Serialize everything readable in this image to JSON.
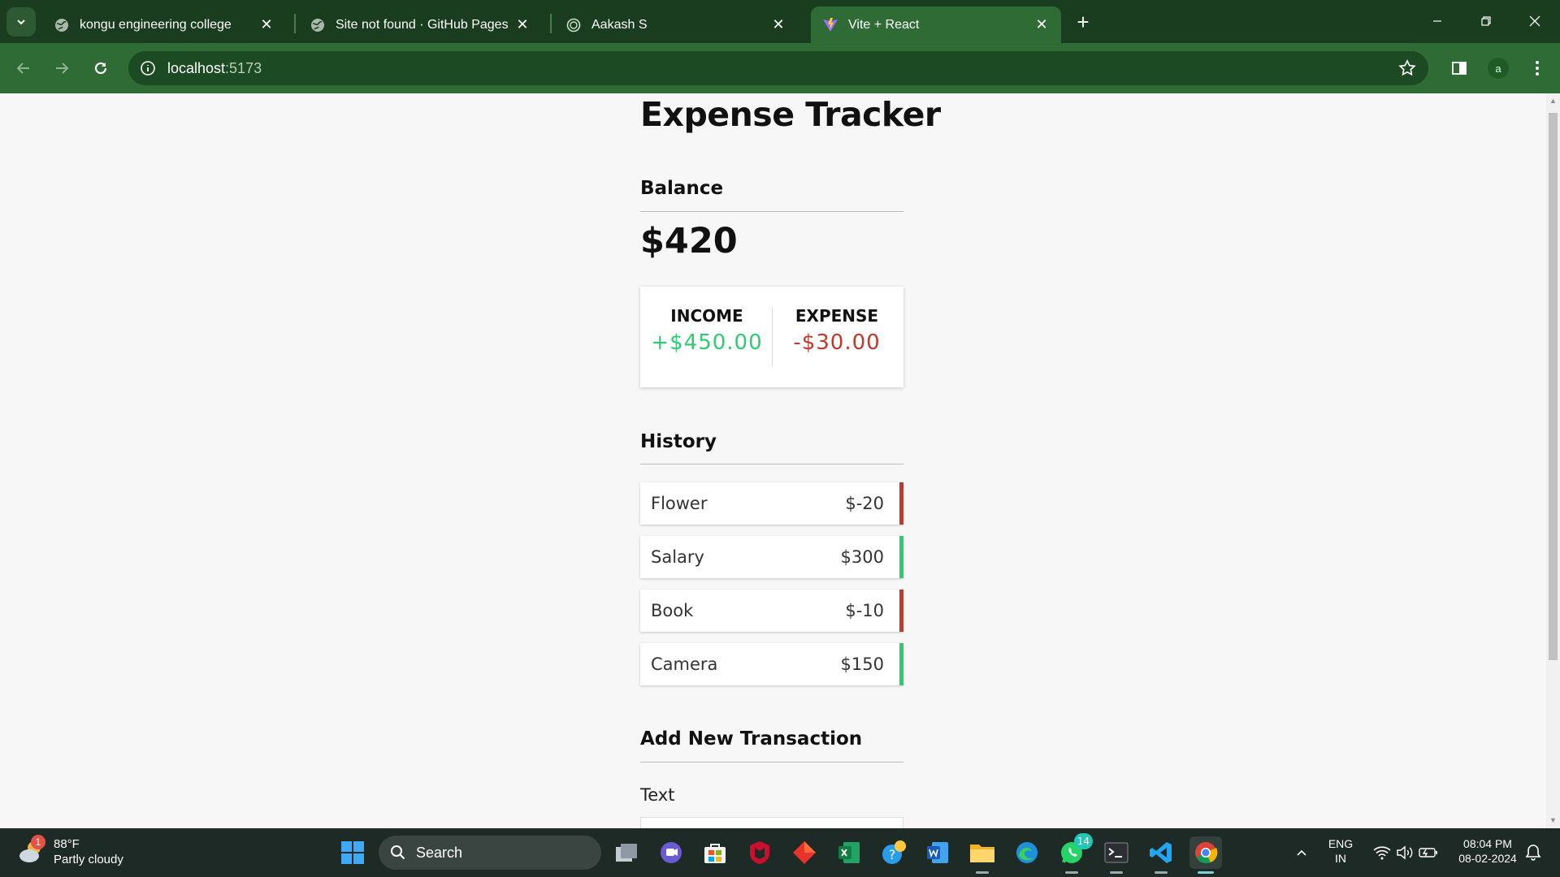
{
  "browser": {
    "tabs": [
      {
        "title": "kongu engineering college",
        "icon": "globe-icon"
      },
      {
        "title": "Site not found · GitHub Pages",
        "icon": "globe-icon"
      },
      {
        "title": "Aakash S",
        "icon": "circle-icon"
      },
      {
        "title": "Vite + React",
        "icon": "vite-icon",
        "active": true
      }
    ],
    "url_host": "localhost",
    "url_port": ":5173",
    "profile_initial": "a"
  },
  "app": {
    "title": "Expense Tracker",
    "balance_heading": "Balance",
    "balance_amount": "$420",
    "income_label": "INCOME",
    "income_amount": "+$450.00",
    "expense_label": "EXPENSE",
    "expense_amount": "-$30.00",
    "history_heading": "History",
    "transactions": [
      {
        "text": "Flower",
        "amount": "$-20",
        "type": "negative"
      },
      {
        "text": "Salary",
        "amount": "$300",
        "type": "positive"
      },
      {
        "text": "Book",
        "amount": "$-10",
        "type": "negative"
      },
      {
        "text": "Camera",
        "amount": "$150",
        "type": "positive"
      }
    ],
    "add_heading": "Add New Transaction",
    "text_label": "Text"
  },
  "colors": {
    "positive": "#2ecc71",
    "negative": "#c0392b",
    "chrome_dark": "#193d1e",
    "chrome_light": "#2e6b35"
  },
  "taskbar": {
    "weather_temp": "88°F",
    "weather_desc": "Partly cloudy",
    "weather_badge": "1",
    "search_label": "Search",
    "whatsapp_badge": "14",
    "lang_line1": "ENG",
    "lang_line2": "IN",
    "time": "08:04 PM",
    "date": "08-02-2024"
  }
}
